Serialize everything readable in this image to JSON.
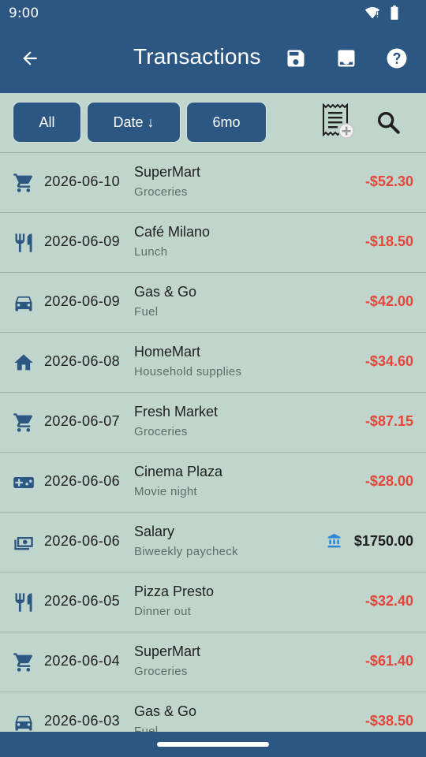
{
  "status_bar": {
    "time": "9:00"
  },
  "app_bar": {
    "title": "Transactions"
  },
  "filters": {
    "all_label": "All",
    "sort_label": "Date ↓",
    "range_label": "6mo"
  },
  "colors": {
    "primary": "#2c5783",
    "background": "#c0d6cd",
    "negative": "#e6453a",
    "bank_accent": "#2a86d6"
  },
  "transactions": [
    {
      "icon": "cart-icon",
      "date": "2026-06-10",
      "name": "SuperMart",
      "desc": "Groceries",
      "amount": "-$52.30",
      "type": "expense"
    },
    {
      "icon": "fork-knife-icon",
      "date": "2026-06-09",
      "name": "Café Milano",
      "desc": "Lunch",
      "amount": "-$18.50",
      "type": "expense"
    },
    {
      "icon": "car-icon",
      "date": "2026-06-09",
      "name": "Gas & Go",
      "desc": "Fuel",
      "amount": "-$42.00",
      "type": "expense"
    },
    {
      "icon": "home-icon",
      "date": "2026-06-08",
      "name": "HomeMart",
      "desc": "Household supplies",
      "amount": "-$34.60",
      "type": "expense"
    },
    {
      "icon": "cart-icon",
      "date": "2026-06-07",
      "name": "Fresh Market",
      "desc": "Groceries",
      "amount": "-$87.15",
      "type": "expense"
    },
    {
      "icon": "gamepad-icon",
      "date": "2026-06-06",
      "name": "Cinema Plaza",
      "desc": "Movie night",
      "amount": "-$28.00",
      "type": "expense"
    },
    {
      "icon": "money-icon",
      "date": "2026-06-06",
      "name": "Salary",
      "desc": "Biweekly paycheck",
      "amount": "$1750.00",
      "type": "income"
    },
    {
      "icon": "fork-knife-icon",
      "date": "2026-06-05",
      "name": "Pizza Presto",
      "desc": "Dinner out",
      "amount": "-$32.40",
      "type": "expense"
    },
    {
      "icon": "cart-icon",
      "date": "2026-06-04",
      "name": "SuperMart",
      "desc": "Groceries",
      "amount": "-$61.40",
      "type": "expense"
    },
    {
      "icon": "car-icon",
      "date": "2026-06-03",
      "name": "Gas & Go",
      "desc": "Fuel",
      "amount": "-$38.50",
      "type": "expense"
    }
  ]
}
